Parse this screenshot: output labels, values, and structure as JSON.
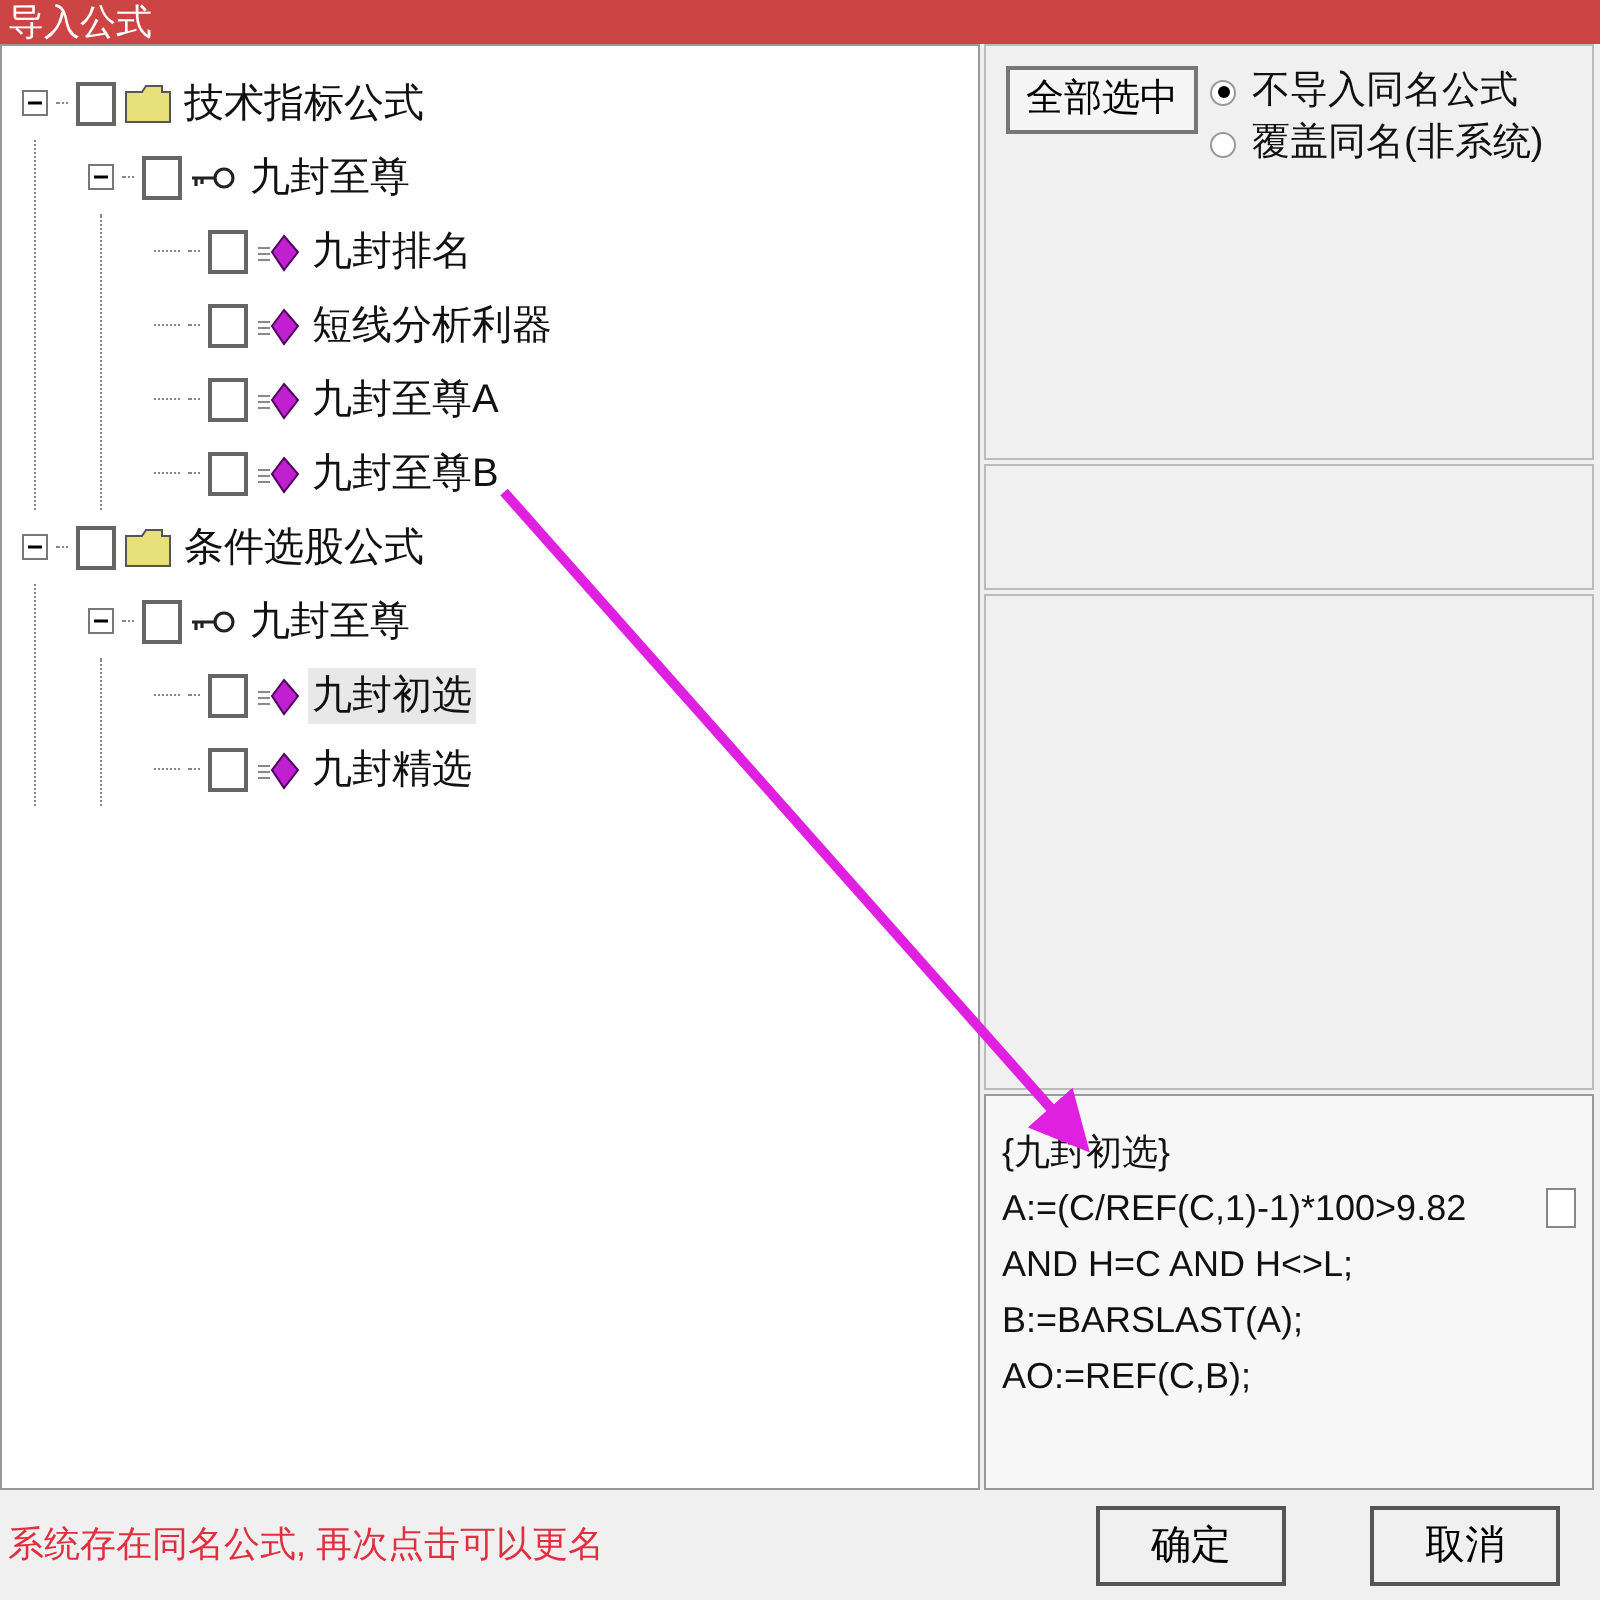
{
  "window": {
    "title": "导入公式"
  },
  "tree": [
    {
      "kind": "folder",
      "label": "技术指标公式",
      "checked": false,
      "expanded": true,
      "selected": false,
      "children": [
        {
          "kind": "group",
          "label": "九封至尊",
          "checked": false,
          "expanded": true,
          "selected": false,
          "children": [
            {
              "kind": "formula",
              "label": "九封排名",
              "checked": false,
              "selected": false
            },
            {
              "kind": "formula",
              "label": "短线分析利器",
              "checked": false,
              "selected": false
            },
            {
              "kind": "formula",
              "label": "九封至尊A",
              "checked": false,
              "selected": false
            },
            {
              "kind": "formula",
              "label": "九封至尊B",
              "checked": false,
              "selected": false
            }
          ]
        }
      ]
    },
    {
      "kind": "folder",
      "label": "条件选股公式",
      "checked": false,
      "expanded": true,
      "selected": false,
      "children": [
        {
          "kind": "group",
          "label": "九封至尊",
          "checked": false,
          "expanded": true,
          "selected": false,
          "children": [
            {
              "kind": "formula",
              "label": "九封初选",
              "checked": false,
              "selected": true
            },
            {
              "kind": "formula",
              "label": "九封精选",
              "checked": false,
              "selected": false
            }
          ]
        }
      ]
    }
  ],
  "select_all_button": "全部选中",
  "options": [
    {
      "label": "不导入同名公式",
      "selected": true
    },
    {
      "label": "覆盖同名(非系统)",
      "selected": false
    }
  ],
  "code_box": {
    "lines": [
      "{九封初选}",
      "A:=(C/REF(C,1)-1)*100>9.82",
      "AND H=C AND H<>L;",
      "B:=BARSLAST(A);",
      "AO:=REF(C,B);"
    ],
    "checked": false
  },
  "status_message": "系统存在同名公式, 再次点击可以更名",
  "buttons": [
    "确定",
    "取消"
  ]
}
